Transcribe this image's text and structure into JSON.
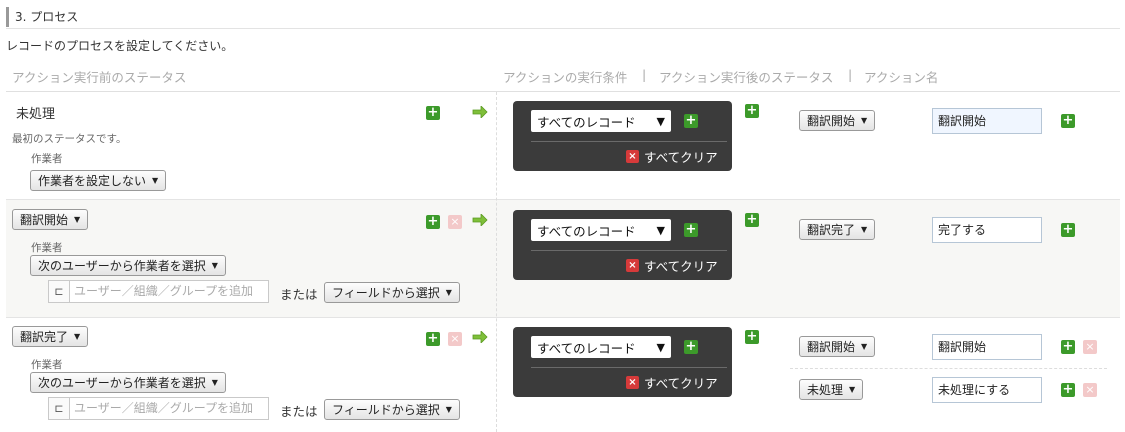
{
  "section": {
    "title": "3. プロセス",
    "description": "レコードのプロセスを設定してください。"
  },
  "columns": {
    "before_status": "アクション実行前のステータス",
    "condition": "アクションの実行条件",
    "sep1": "|",
    "after_status": "アクション実行後のステータス",
    "sep2": "|",
    "action_name": "アクション名"
  },
  "common": {
    "worker_label": "作業者",
    "user_placeholder": "ユーザー／組織／グループを追加",
    "or_label": "または",
    "field_select": "フィールドから選択",
    "condition_select": "すべてのレコード",
    "clear_all": "すべてクリア",
    "dropdown_arrow": "▼"
  },
  "rows": [
    {
      "status_name": "未処理",
      "status_note": "最初のステータスです。",
      "worker_select": "作業者を設定しない",
      "actions": [
        {
          "next_status": "翻訳開始",
          "action_name": "翻訳開始"
        }
      ]
    },
    {
      "status_select": "翻訳開始",
      "worker_select": "次のユーザーから作業者を選択",
      "actions": [
        {
          "next_status": "翻訳完了",
          "action_name": "完了する"
        }
      ]
    },
    {
      "status_select": "翻訳完了",
      "worker_select": "次のユーザーから作業者を選択",
      "actions": [
        {
          "next_status": "翻訳開始",
          "action_name": "翻訳開始"
        },
        {
          "next_status": "未処理",
          "action_name": "未処理にする"
        }
      ]
    }
  ],
  "icons": {
    "add": "plus-icon",
    "remove": "remove-icon",
    "arrow": "arrow-right-icon",
    "clear": "close-icon",
    "tree": "org-tree-icon"
  },
  "colors": {
    "add": "#3c9a2a",
    "remove_disabled": "#f3c9c9",
    "clear": "#d63a3a",
    "condition_bg": "#3b3b3b"
  }
}
